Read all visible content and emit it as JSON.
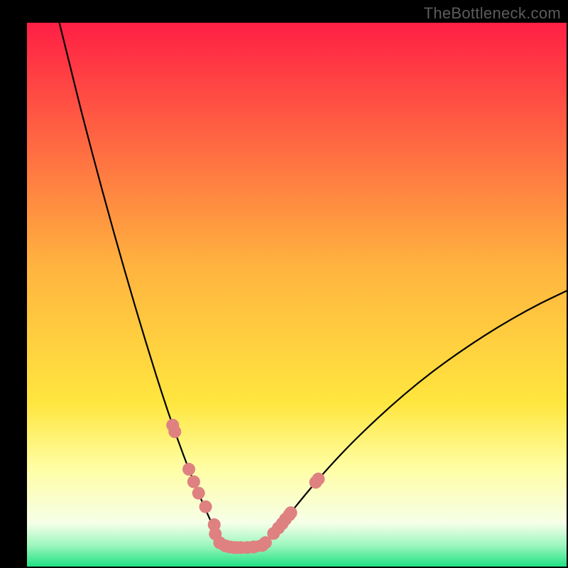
{
  "watermark": "TheBottleneck.com",
  "chart_data": {
    "type": "line",
    "title": "",
    "xlabel": "",
    "ylabel": "",
    "xlim": [
      0,
      100
    ],
    "ylim": [
      0,
      100
    ],
    "background": {
      "gradient_stops": [
        {
          "offset": 0.0,
          "color": "#ff1f45"
        },
        {
          "offset": 0.45,
          "color": "#ffb43f"
        },
        {
          "offset": 0.7,
          "color": "#ffe63f"
        },
        {
          "offset": 0.82,
          "color": "#fffea5"
        },
        {
          "offset": 0.92,
          "color": "#f6ffe8"
        },
        {
          "offset": 0.96,
          "color": "#9ff7bf"
        },
        {
          "offset": 1.0,
          "color": "#21e183"
        }
      ],
      "border": "#000000"
    },
    "series": [
      {
        "name": "left-curve",
        "type": "line",
        "color": "#000000",
        "x": [
          6,
          8,
          10,
          12,
          14,
          16,
          18,
          20,
          22,
          23,
          24,
          25,
          26,
          27,
          28,
          29,
          30,
          31,
          32,
          33,
          34,
          35,
          35.7
        ],
        "y": [
          100,
          92,
          84,
          76.4,
          69,
          61.8,
          54.8,
          48,
          41.4,
          38.2,
          35,
          31.9,
          28.9,
          26,
          23.2,
          20.5,
          17.9,
          15.4,
          13,
          10.7,
          8.5,
          6.4,
          4.4
        ]
      },
      {
        "name": "right-curve",
        "type": "line",
        "color": "#000000",
        "x": [
          44,
          45,
          46,
          47,
          48,
          50,
          53,
          56,
          60,
          65,
          70,
          75,
          80,
          85,
          90,
          95,
          100
        ],
        "y": [
          4.2,
          5.3,
          6.4,
          7.5,
          8.8,
          11.3,
          14.9,
          18.3,
          22.5,
          27.3,
          31.7,
          35.7,
          39.3,
          42.6,
          45.6,
          48.3,
          50.7
        ]
      },
      {
        "name": "trough",
        "type": "line",
        "color": "#de8180",
        "x": [
          35.7,
          36.5,
          37.5,
          38.5,
          39.5,
          40.5,
          41.5,
          42.5,
          43.5,
          44
        ],
        "y": [
          4.4,
          3.9,
          3.6,
          3.5,
          3.5,
          3.5,
          3.6,
          3.7,
          3.9,
          4.2
        ]
      }
    ],
    "marker_series": [
      {
        "name": "left-markers",
        "color": "#de8180",
        "radius": 9,
        "x": [
          27.0,
          27.4,
          30.0,
          30.9,
          31.8,
          33.1,
          34.7,
          34.9
        ],
        "y": [
          26.0,
          24.8,
          17.9,
          15.6,
          13.5,
          11.0,
          7.7,
          6.0
        ]
      },
      {
        "name": "trough-markers",
        "color": "#de8180",
        "radius": 9,
        "x": [
          35.7,
          36.8,
          37.6,
          38.4,
          38.8,
          39.6,
          40.8,
          42.0,
          43.6
        ],
        "y": [
          4.4,
          3.8,
          3.6,
          3.5,
          3.5,
          3.5,
          3.5,
          3.6,
          3.9
        ]
      },
      {
        "name": "right-markers",
        "color": "#de8180",
        "radius": 9,
        "x": [
          44.2,
          45.7,
          46.6,
          47.3,
          47.9,
          48.6,
          48.9,
          53.5,
          54.0
        ],
        "y": [
          4.4,
          6.1,
          7.1,
          7.9,
          8.7,
          9.5,
          9.9,
          15.5,
          16.1
        ]
      }
    ]
  }
}
